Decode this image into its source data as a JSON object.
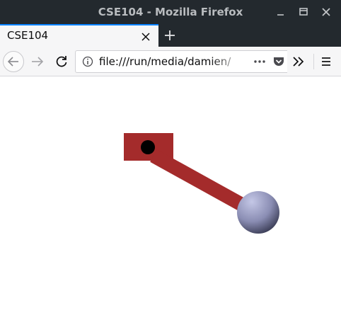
{
  "window": {
    "title": "CSE104 - Mozilla Firefox",
    "controls": [
      "minimize-icon",
      "maximize-icon",
      "close-icon"
    ]
  },
  "tabs": [
    {
      "label": "CSE104",
      "active": true
    }
  ],
  "nav": {
    "url": "file:///run/media/damien/",
    "icons": [
      "back-arrow-icon",
      "forward-arrow-icon",
      "reload-icon",
      "info-icon",
      "page-actions-icon",
      "pocket-icon",
      "overflow-icon",
      "menu-icon"
    ]
  },
  "scene": {
    "description_colors": {
      "arm": "#a42b2b",
      "pivot": "#000000",
      "bob_light": "#b5b8d8",
      "bob_dark": "#3a3d58"
    }
  },
  "colors": {
    "titlebar": "#23292e",
    "tab_accent": "#0a84ff",
    "toolbar": "#f6f6f7"
  }
}
